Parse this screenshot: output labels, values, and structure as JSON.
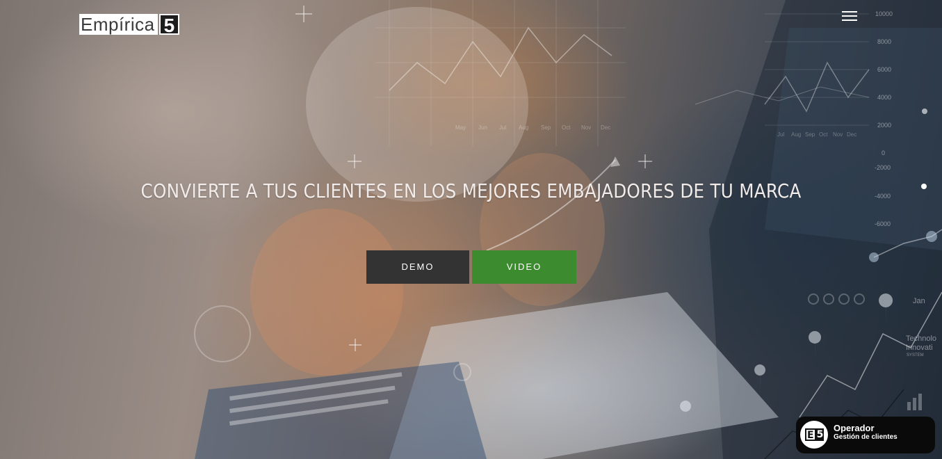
{
  "header": {
    "logo_text": "Empírica",
    "logo_number": "5",
    "menu_icon": "hamburger-menu-icon"
  },
  "hero": {
    "headline": "CONVIERTE A TUS CLIENTES EN LOS MEJORES EMBAJADORES DE TU MARCA",
    "buttons": {
      "demo_label": "DEMO",
      "video_label": "VIDEO"
    }
  },
  "background_chart": {
    "y_ticks": [
      "10000",
      "8000",
      "6000",
      "4000",
      "2000",
      "0",
      "-2000",
      "-4000",
      "-6000"
    ],
    "months_left": [
      "May",
      "Jun",
      "Jul",
      "Aug",
      "Sep",
      "Oct",
      "Nov",
      "Dec"
    ],
    "months_right": [
      "Jul",
      "Aug",
      "Sep",
      "Oct",
      "Nov",
      "Dec"
    ],
    "corner_label": "Jan",
    "corner_text_1": "Technolo",
    "corner_text_2": "Innovati",
    "corner_text_3": "SYSTEM"
  },
  "operator_widget": {
    "logo_e": "E",
    "logo_number": "5",
    "title": "Operador",
    "subtitle": "Gestión de clientes"
  },
  "colors": {
    "demo_button": "#333333",
    "video_button": "#3c8b2e",
    "widget_background": "#0a0a0a"
  }
}
